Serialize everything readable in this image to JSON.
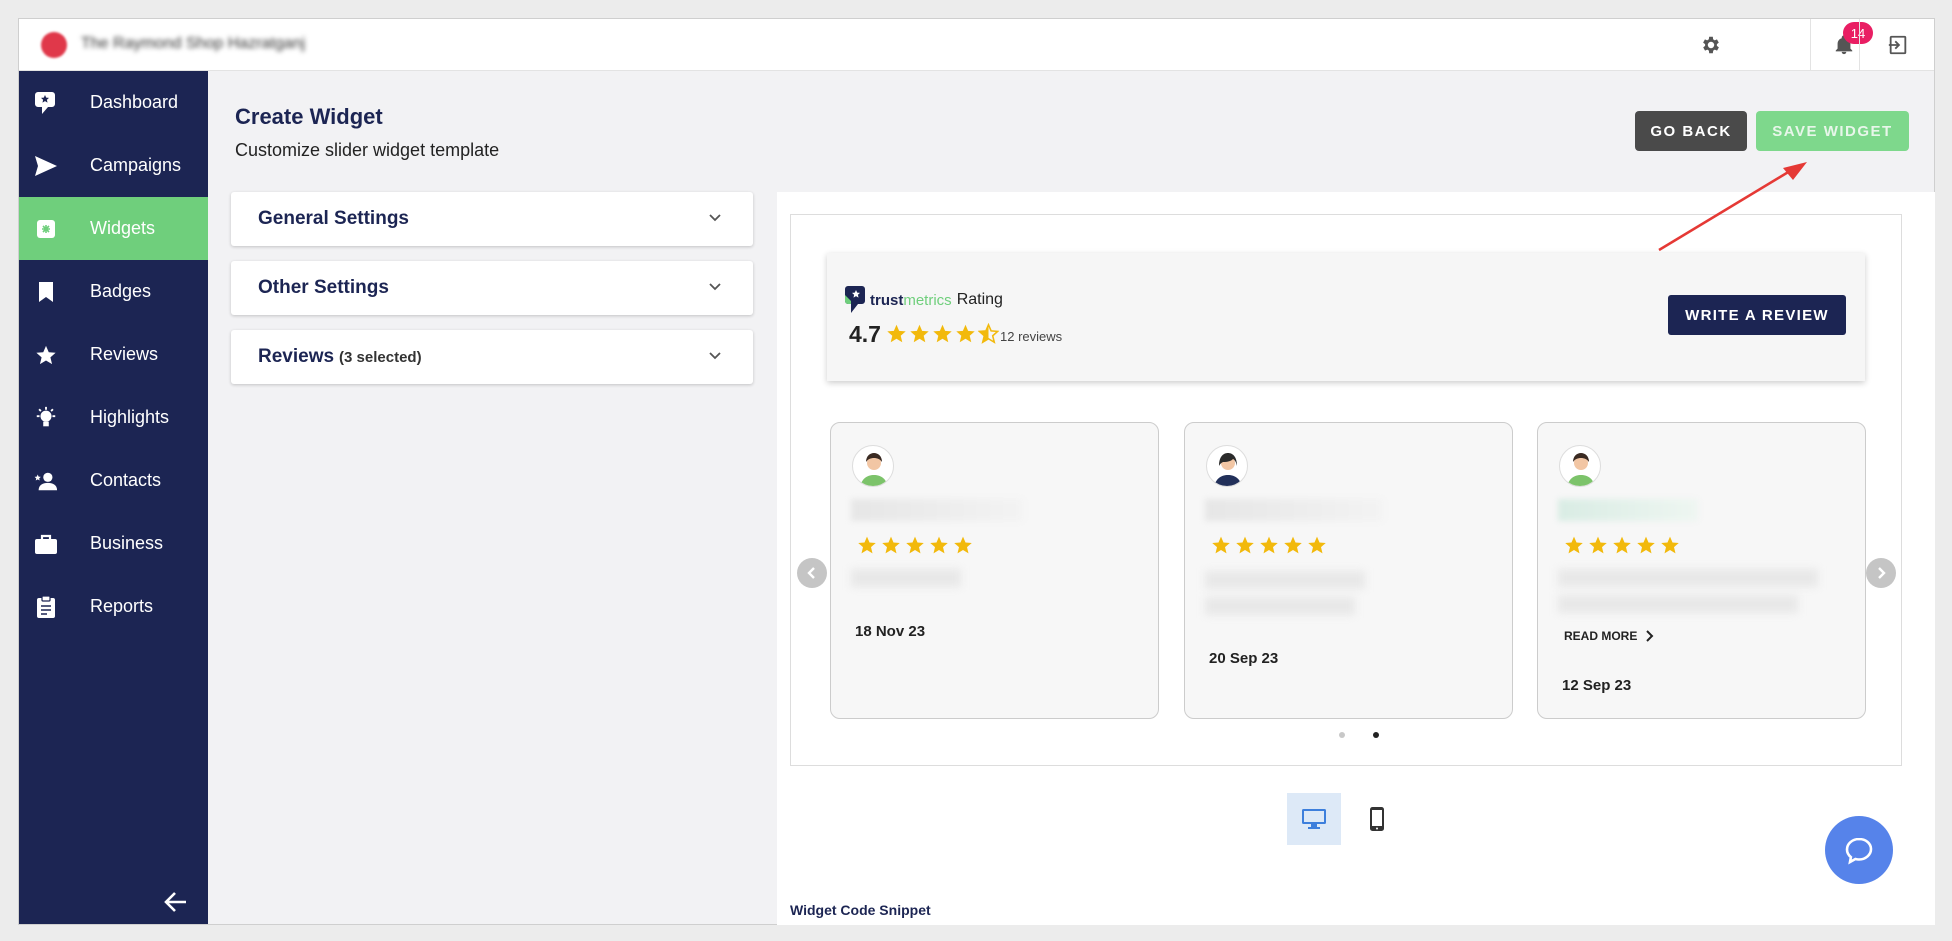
{
  "topbar": {
    "brand_name": "The Raymond Shop Hazratganj",
    "notification_count": "14"
  },
  "sidebar": {
    "items": [
      {
        "label": "Dashboard",
        "icon": "trustmetrics-logo-icon"
      },
      {
        "label": "Campaigns",
        "icon": "send-icon"
      },
      {
        "label": "Widgets",
        "icon": "widget-icon",
        "active": true
      },
      {
        "label": "Badges",
        "icon": "bookmark-icon"
      },
      {
        "label": "Reviews",
        "icon": "star-icon"
      },
      {
        "label": "Highlights",
        "icon": "lightbulb-icon"
      },
      {
        "label": "Contacts",
        "icon": "contacts-icon"
      },
      {
        "label": "Business",
        "icon": "briefcase-icon"
      },
      {
        "label": "Reports",
        "icon": "clipboard-icon"
      }
    ]
  },
  "header": {
    "title": "Create Widget",
    "subtitle": "Customize slider widget template",
    "go_back_label": "GO BACK",
    "save_label": "SAVE WIDGET"
  },
  "settings": {
    "general": "General Settings",
    "other": "Other Settings",
    "reviews": "Reviews",
    "reviews_sub": "(3 selected)"
  },
  "preview": {
    "brand_part1": "trust",
    "brand_part2": "metrics",
    "rating_label": "Rating",
    "average": "4.7",
    "review_count": "12 reviews",
    "write_review_label": "WRITE A REVIEW",
    "cards": [
      {
        "date": "18 Nov 23",
        "stars": 5,
        "read_more": ""
      },
      {
        "date": "20 Sep 23",
        "stars": 5,
        "read_more": ""
      },
      {
        "date": "12 Sep 23",
        "stars": 5,
        "read_more": "READ MORE"
      }
    ],
    "active_dot": 2
  },
  "snippet_label": "Widget Code Snippet",
  "colors": {
    "sidebar_bg": "#1c2553",
    "accent_green": "#6fcf7c",
    "star_gold": "#f2b90c",
    "badge_pink": "#e91e63",
    "fab_blue": "#5683ea"
  }
}
